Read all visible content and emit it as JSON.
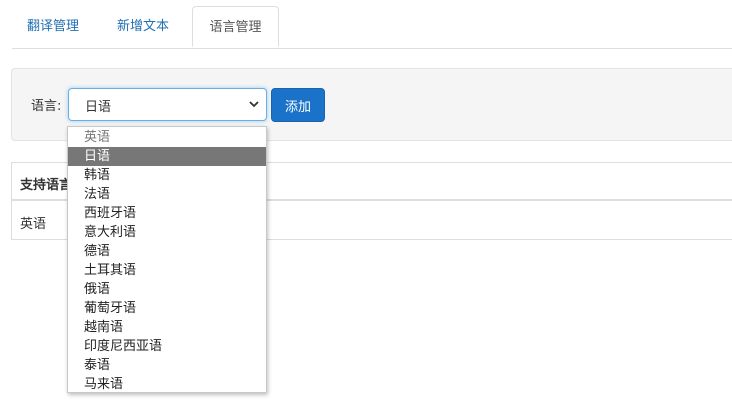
{
  "tabs": [
    {
      "label": "翻译管理",
      "active": false
    },
    {
      "label": "新增文本",
      "active": false
    },
    {
      "label": "语言管理",
      "active": true
    }
  ],
  "form": {
    "label": "语言:",
    "selected_value": "日语",
    "add_button": "添加"
  },
  "table": {
    "header": "支持语言",
    "rows": [
      "英语"
    ]
  },
  "dropdown": {
    "options": [
      "英语",
      "日语",
      "韩语",
      "法语",
      "西班牙语",
      "意大利语",
      "德语",
      "土耳其语",
      "俄语",
      "葡萄牙语",
      "越南语",
      "印度尼西亚语",
      "泰语",
      "马来语"
    ],
    "disabled_option": "英语",
    "highlighted_option": "日语"
  },
  "colors": {
    "accent": "#1a73c9",
    "tab_link": "#1f6fb2",
    "highlight": "#777777"
  }
}
